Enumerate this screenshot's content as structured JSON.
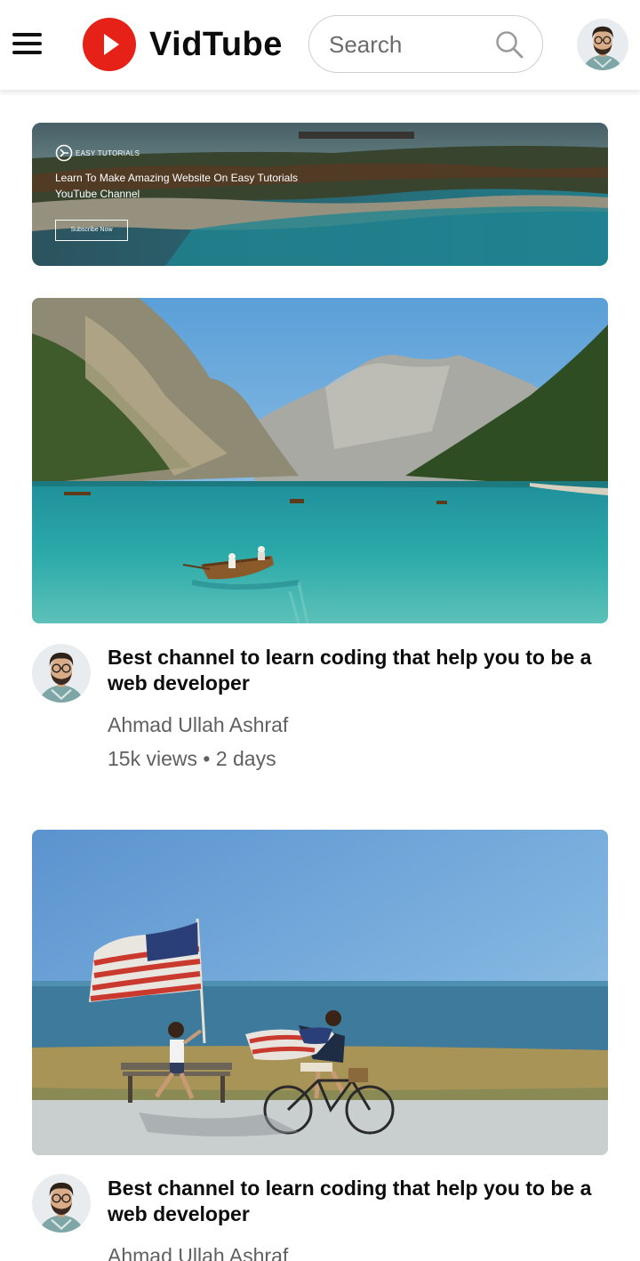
{
  "header": {
    "logo_text": "VidTube",
    "search_placeholder": "Search"
  },
  "banner": {
    "brand": "EASY TUTORIALS",
    "line1": "Learn To Make Amazing Website On Easy Tutorials",
    "line2": "YouTube Channel",
    "button": "Subscribe Now"
  },
  "videos": [
    {
      "title": "Best channel to learn coding that help you to be a web developer",
      "channel": "Ahmad Ullah Ashraf",
      "meta": "15k views • 2 days"
    },
    {
      "title": "Best channel to learn coding that help you to be a web developer",
      "channel": "Ahmad Ullah Ashraf"
    }
  ],
  "colors": {
    "brand_red": "#e62117",
    "text_primary": "#0d0d0d",
    "text_secondary": "#606060"
  },
  "icons": [
    "menu-icon",
    "play-logo-icon",
    "search-icon",
    "avatar"
  ]
}
